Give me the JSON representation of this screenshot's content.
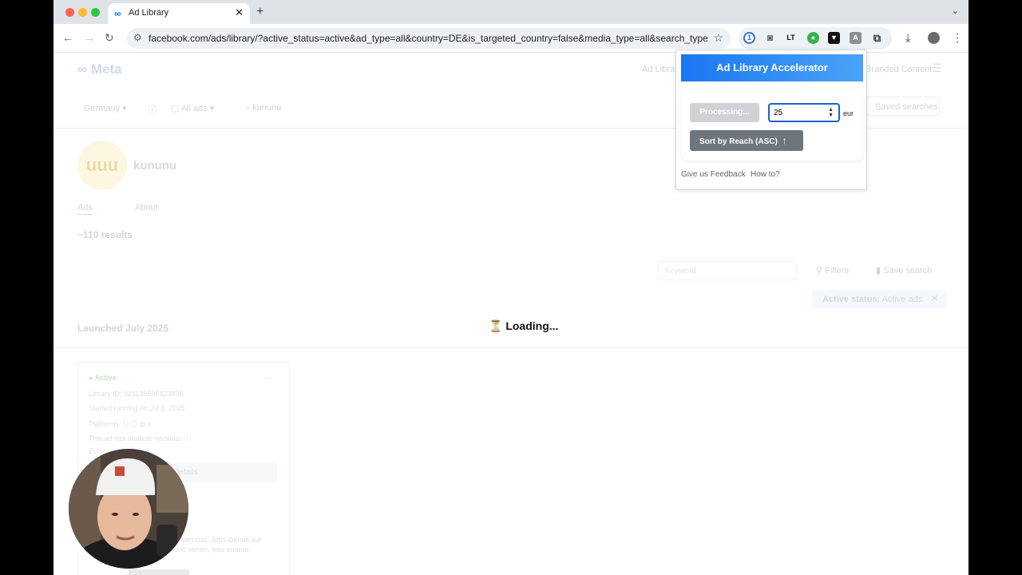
{
  "browser": {
    "tab_title": "Ad Library",
    "tab_favicon": "meta-icon",
    "url": "facebook.com/ads/library/?active_status=active&ad_type=all&country=DE&is_targeted_country=false&media_type=all&search_type=pa..."
  },
  "page": {
    "nav_ad_library": "Ad Library",
    "nav_branded": "Branded Content",
    "filter_country": "Germany",
    "filter_ad_type": "All ads",
    "search_query": "kununu",
    "saved_searches": "Saved searches",
    "advertiser_name": "kununu",
    "advertiser_logo_text": "uuu",
    "tab_ads": "Ads",
    "tab_about": "About",
    "results_count": "~110 results",
    "keyword_placeholder": "Keyword",
    "filters_label": "Filters",
    "save_search_label": "Save search",
    "active_status_label": "Active status:",
    "active_status_value": "Active ads",
    "launched_label": "Launched July 2025",
    "card": {
      "status": "Active",
      "library_id": "Library ID: 921136596823895",
      "started": "Started running on Jul 1, 2025",
      "platforms": "Platforms",
      "multiple_versions": "This ad has multiple versions",
      "eu": "EU t",
      "details_btn": "d details",
      "body_text": "n wert bist. Jetzt Gehalt auf\n und sehen, was andere"
    },
    "loading_icon": "⏳",
    "loading_text": "Loading..."
  },
  "extension": {
    "title": "Ad Library Accelerator",
    "processing_label": "Processing...",
    "amount_value": "25",
    "currency": "eur",
    "sort_label": "Sort by Reach (ASC)",
    "feedback_link": "Give us Feedback",
    "howto_link": "How to?"
  },
  "colors": {
    "accent": "#1977f2",
    "popup_header_end": "#4aa3f7",
    "sort_button": "#6e767d"
  }
}
